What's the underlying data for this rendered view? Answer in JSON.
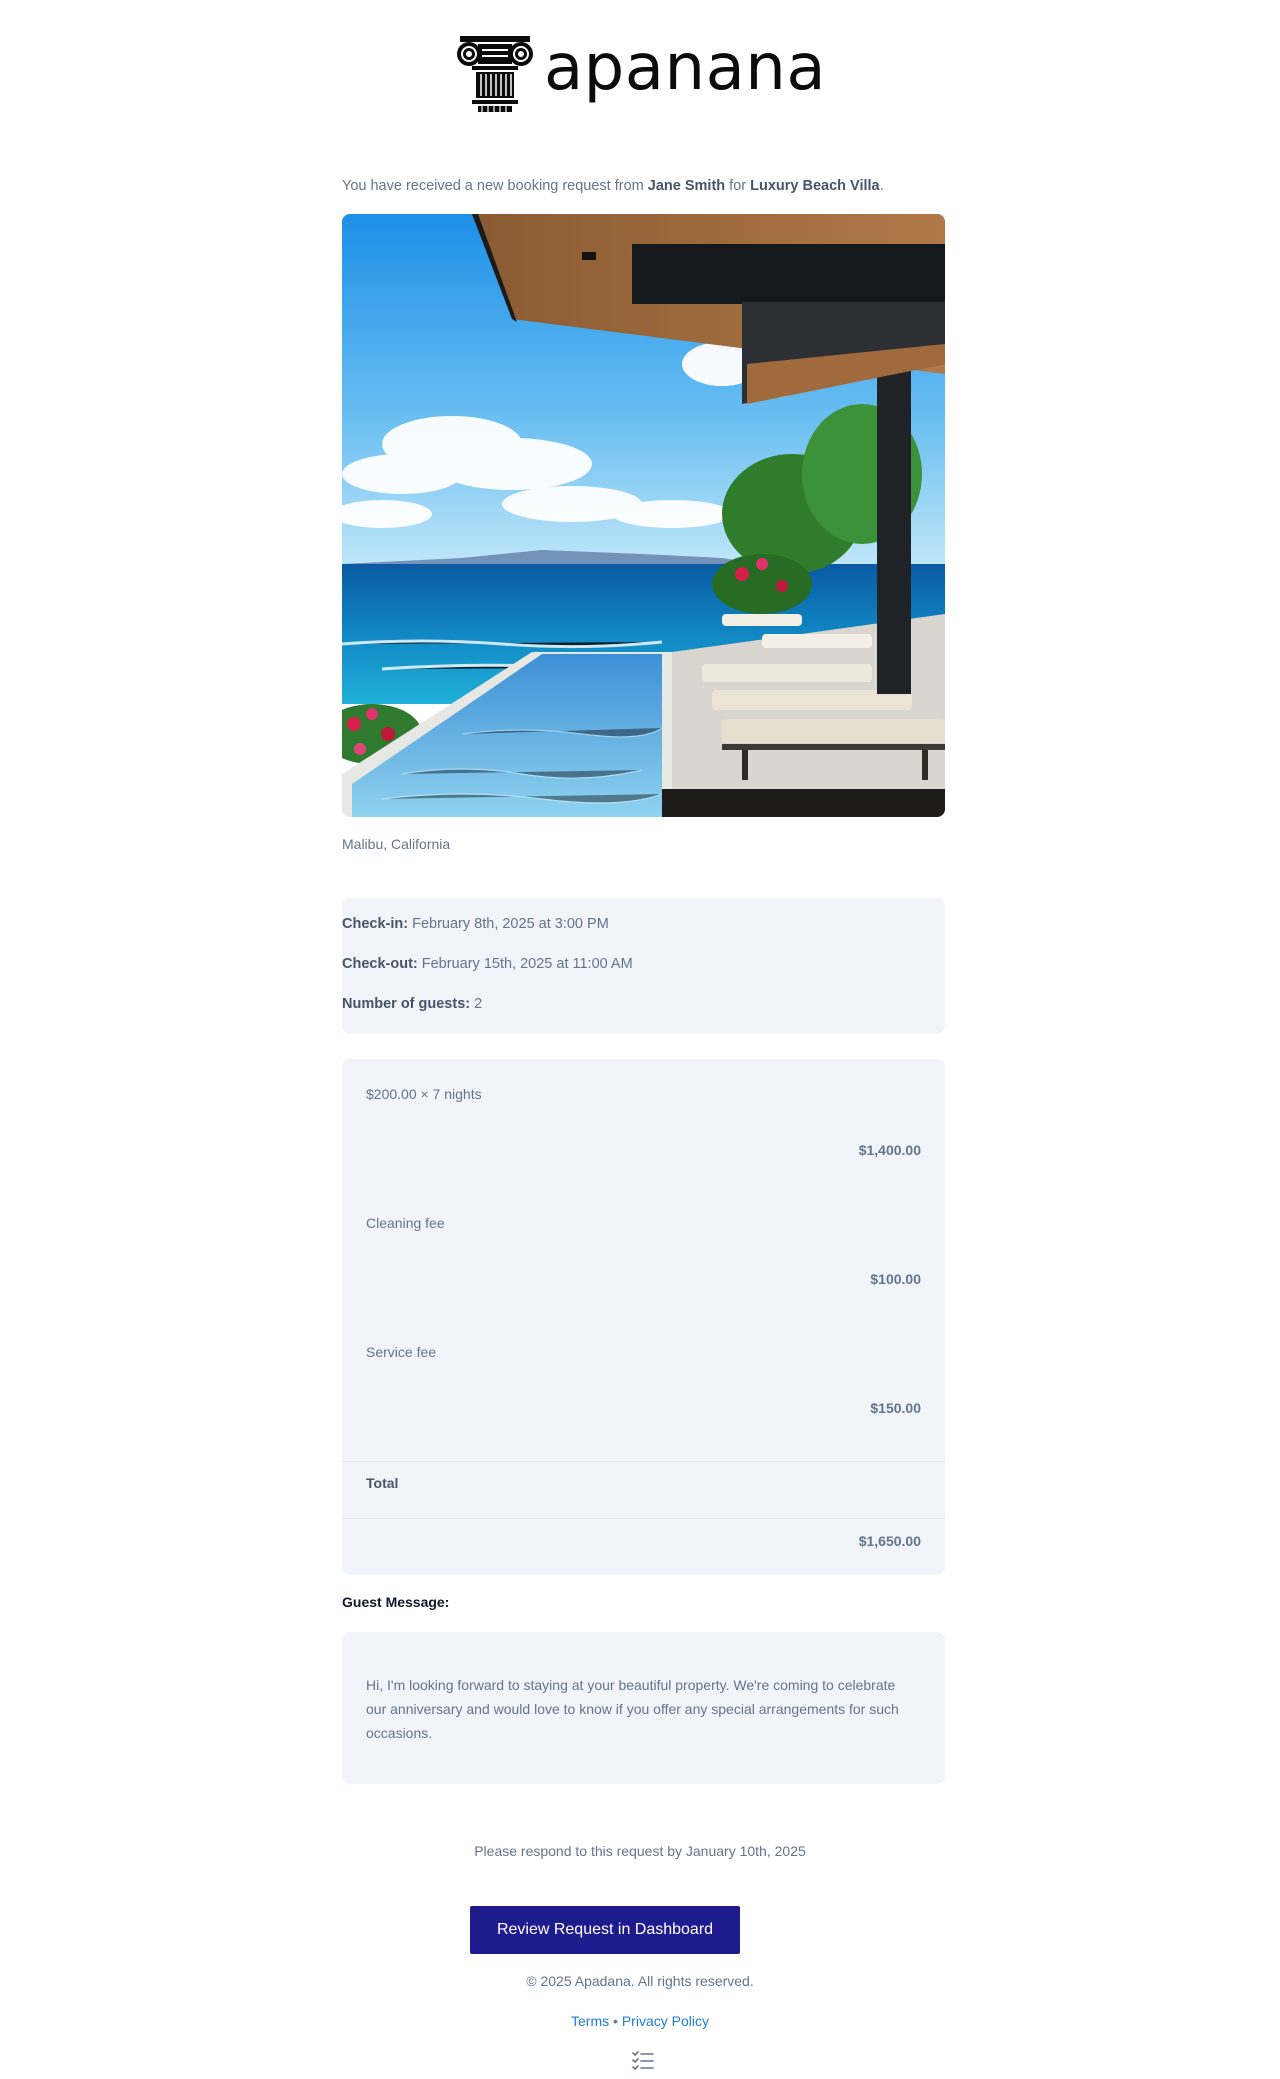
{
  "brand": {
    "name": "apanana",
    "logo_icon": "ionic-column-icon"
  },
  "intro": {
    "prefix": "You have received a new booking request from ",
    "guest_name": "Jane Smith",
    "middle": " for ",
    "property_name": "Luxury Beach Villa",
    "suffix": "."
  },
  "property": {
    "image_alt": "villa-pool-ocean-view-photo",
    "location": "Malibu, California"
  },
  "stay": {
    "checkin_label": "Check-in:",
    "checkin_value": " February 8th, 2025 at 3:00 PM",
    "checkout_label": "Check-out:",
    "checkout_value": " February 15th, 2025 at 11:00 AM",
    "guests_label": "Number of guests:",
    "guests_value": " 2"
  },
  "pricing": {
    "nightly_label": "$200.00 × 7 nights",
    "nightly_amount": "$1,400.00",
    "cleaning_label": "Cleaning fee",
    "cleaning_amount": "$100.00",
    "service_label": "Service fee",
    "service_amount": "$150.00",
    "total_label": "Total",
    "total_amount": "$1,650.00"
  },
  "message": {
    "heading": "Guest Message:",
    "body": "Hi, I'm looking forward to staying at your beautiful property. We're coming to celebrate our anniversary and would love to know if you offer any special arrangements for such occasions."
  },
  "respond_text": "Please respond to this request by January 10th, 2025",
  "cta_label": "Review Request in Dashboard",
  "footer": {
    "copyright": "© 2025 Apadana. All rights reserved.",
    "terms_label": "Terms",
    "separator": " • ",
    "privacy_label": "Privacy Policy",
    "icon": "list-checklist-icon"
  },
  "colors": {
    "accent": "#1e1b8f",
    "link": "#1e7bd6",
    "panel": "#f1f4f8",
    "text_muted": "#64748b"
  }
}
